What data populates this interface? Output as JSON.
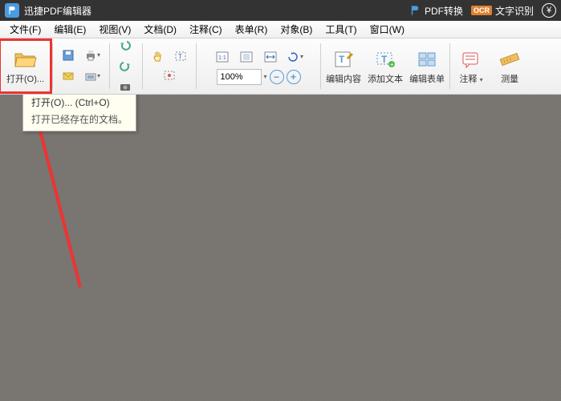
{
  "titlebar": {
    "app_name": "迅捷PDF编辑器",
    "pdf_convert": "PDF转换",
    "ocr_label": "文字识别",
    "yen": "¥"
  },
  "menu": {
    "file": "文件(F)",
    "edit": "编辑(E)",
    "view": "视图(V)",
    "document": "文档(D)",
    "comment": "注释(C)",
    "form": "表单(R)",
    "object": "对象(B)",
    "tool": "工具(T)",
    "window": "窗口(W)"
  },
  "toolbar": {
    "open": "打开(O)...",
    "zoom_value": "100%",
    "edit_content": "编辑内容",
    "add_text": "添加文本",
    "edit_form": "编辑表单",
    "annotate": "注释",
    "measure": "测量"
  },
  "tooltip": {
    "title": "打开(O)... (Ctrl+O)",
    "body": "打开已经存在的文档。"
  },
  "icons": {
    "folder": "folder-icon",
    "save": "save-icon",
    "print": "print-icon",
    "mail": "mail-icon",
    "scan": "scan-icon",
    "undo": "undo-icon",
    "redo": "redo-icon",
    "camera": "camera-icon",
    "hand": "hand-icon",
    "select_text": "select-text-icon",
    "select_annot": "select-annot-icon",
    "fit_page": "fit-page-icon",
    "fit_width": "fit-width-icon",
    "rotate": "rotate-icon",
    "zoom_out": "zoom-out-icon",
    "zoom_in": "zoom-in-icon",
    "edit_content_i": "edit-content-icon",
    "add_text_i": "add-text-icon",
    "edit_form_i": "edit-form-icon",
    "annotate_i": "annotate-icon",
    "measure_i": "measure-icon"
  }
}
